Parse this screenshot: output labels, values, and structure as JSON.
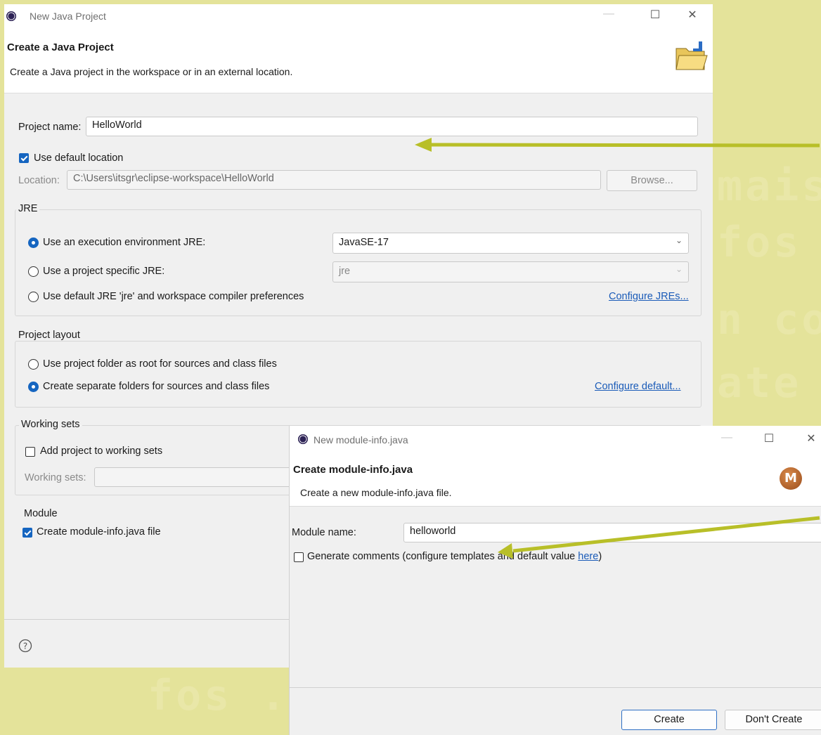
{
  "background": {
    "color": "#e4e39a",
    "watermark_fragments": [
      "mais",
      "fos",
      "n co",
      "ate",
      "fos ."
    ]
  },
  "project_dialog": {
    "window_title": "New Java Project",
    "heading": "Create a Java Project",
    "subheading": "Create a Java project in the workspace or in an external location.",
    "project_name_label": "Project name:",
    "project_name_value": "HelloWorld",
    "use_default_location_label": "Use default location",
    "use_default_location_checked": true,
    "location_label": "Location:",
    "location_value": "C:\\Users\\itsgr\\eclipse-workspace\\HelloWorld",
    "browse_label": "Browse...",
    "jre": {
      "group_label": "JRE",
      "option_exec_env": "Use an execution environment JRE:",
      "option_project_specific": "Use a project specific JRE:",
      "option_default": "Use default JRE 'jre' and workspace compiler preferences",
      "selected": "exec_env",
      "exec_env_value": "JavaSE-17",
      "project_specific_value": "jre",
      "configure_link": "Configure JREs..."
    },
    "layout": {
      "group_label": "Project layout",
      "option_root": "Use project folder as root for sources and class files",
      "option_separate": "Create separate folders for sources and class files",
      "selected": "separate",
      "configure_link": "Configure default..."
    },
    "working_sets": {
      "group_label": "Working sets",
      "add_label": "Add project to working sets",
      "add_checked": false,
      "sets_label": "Working sets:"
    },
    "module": {
      "group_label": "Module",
      "create_label": "Create module-info.java file",
      "create_checked": true
    },
    "help_icon": "question-circle-icon"
  },
  "module_dialog": {
    "window_title": "New module-info.java",
    "heading": "Create module-info.java",
    "subheading": "Create a new module-info.java file.",
    "module_name_label": "Module name:",
    "module_name_value": "helloworld",
    "generate_comments_label": "Generate comments (configure templates and default value ",
    "generate_comments_link": "here",
    "generate_comments_suffix": ")",
    "generate_comments_checked": false,
    "create_button": "Create",
    "dont_create_button": "Don't Create",
    "banner_icon_letter": "M"
  },
  "colors": {
    "arrow": "#b8bf28",
    "accent": "#1565c0",
    "link": "#1a5bb8"
  }
}
